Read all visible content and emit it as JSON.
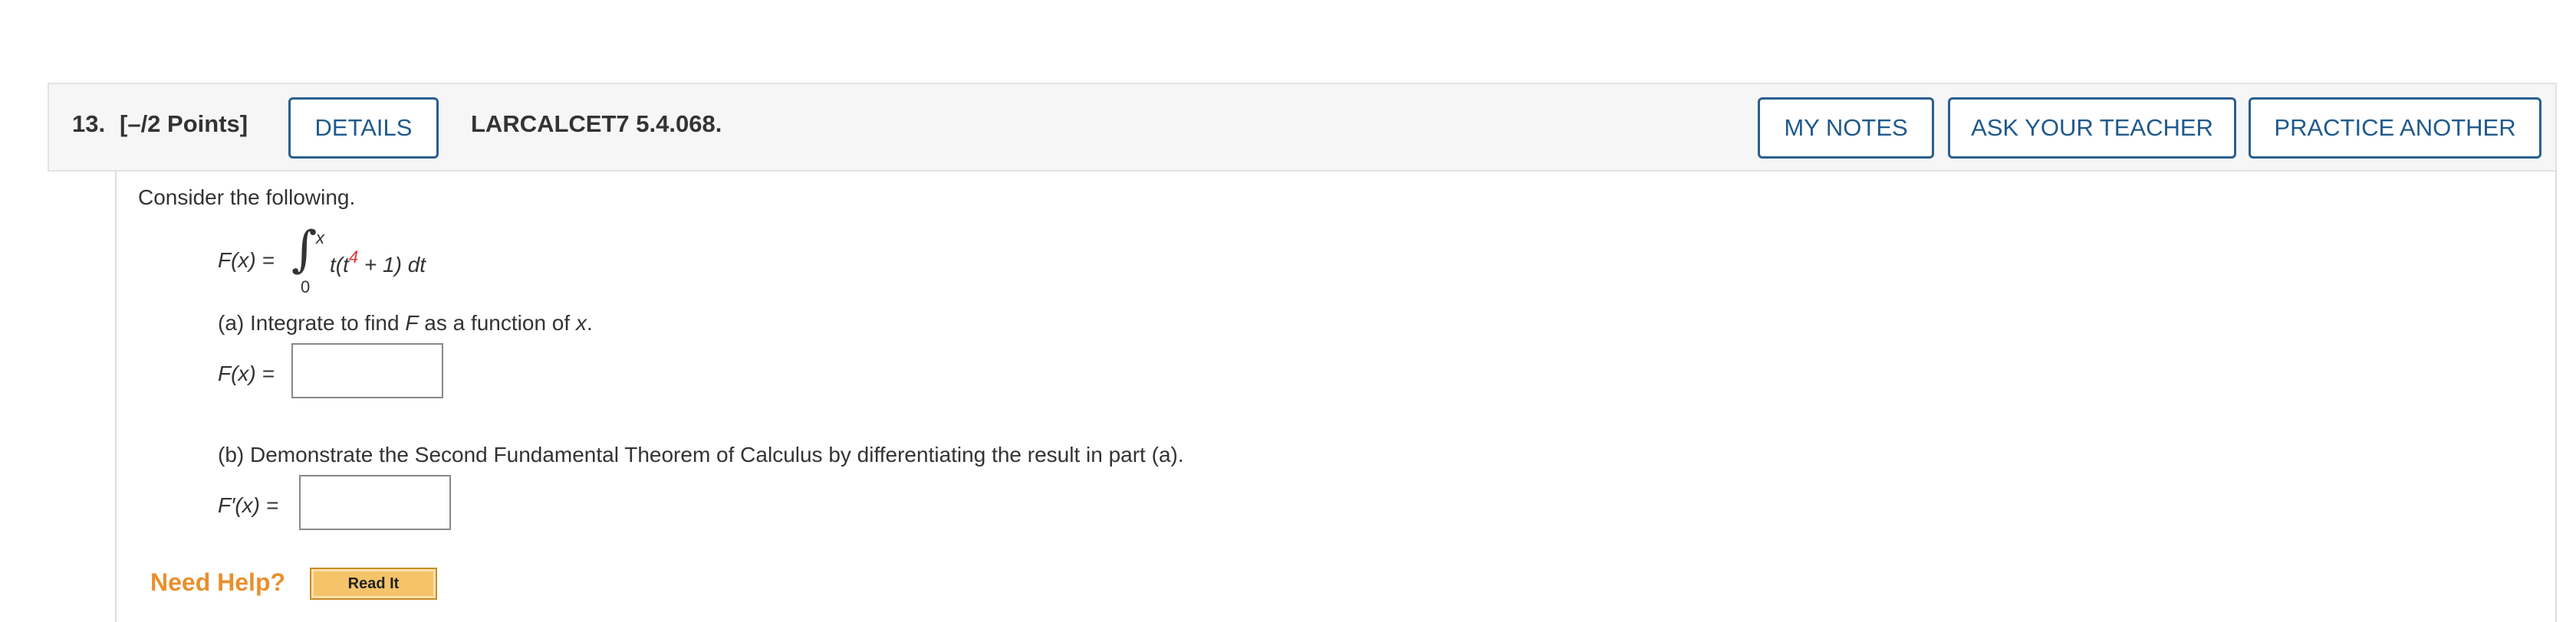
{
  "question": {
    "number": "13.",
    "points": "[–/2 Points]",
    "code": "LARCALCET7 5.4.068."
  },
  "buttons": {
    "details": "DETAILS",
    "my_notes": "MY NOTES",
    "ask_teacher": "ASK YOUR TEACHER",
    "practice_another": "PRACTICE ANOTHER"
  },
  "body": {
    "intro": "Consider the following.",
    "formula": {
      "lhs": "F(x) =",
      "integral_upper": "x",
      "integral_lower": "0",
      "integrand_pre": "t(t",
      "exponent": "4",
      "integrand_post": " + 1) dt"
    },
    "part_a": {
      "text_1": "(a) Integrate to find ",
      "var_F": "F",
      "text_2": " as a function of ",
      "var_x": "x",
      "text_3": ".",
      "label": "F(x) =",
      "answer_value": ""
    },
    "part_b": {
      "text": "(b) Demonstrate the Second Fundamental Theorem of Calculus by differentiating the result in part (a).",
      "label": "F′(x) =",
      "answer_value": ""
    }
  },
  "help": {
    "need_help": "Need Help?",
    "read_it": "Read It"
  },
  "colors": {
    "button_border": "#2b5f8f",
    "button_text": "#1f5a8c",
    "exponent": "#e03030",
    "need_help": "#e8902c"
  }
}
